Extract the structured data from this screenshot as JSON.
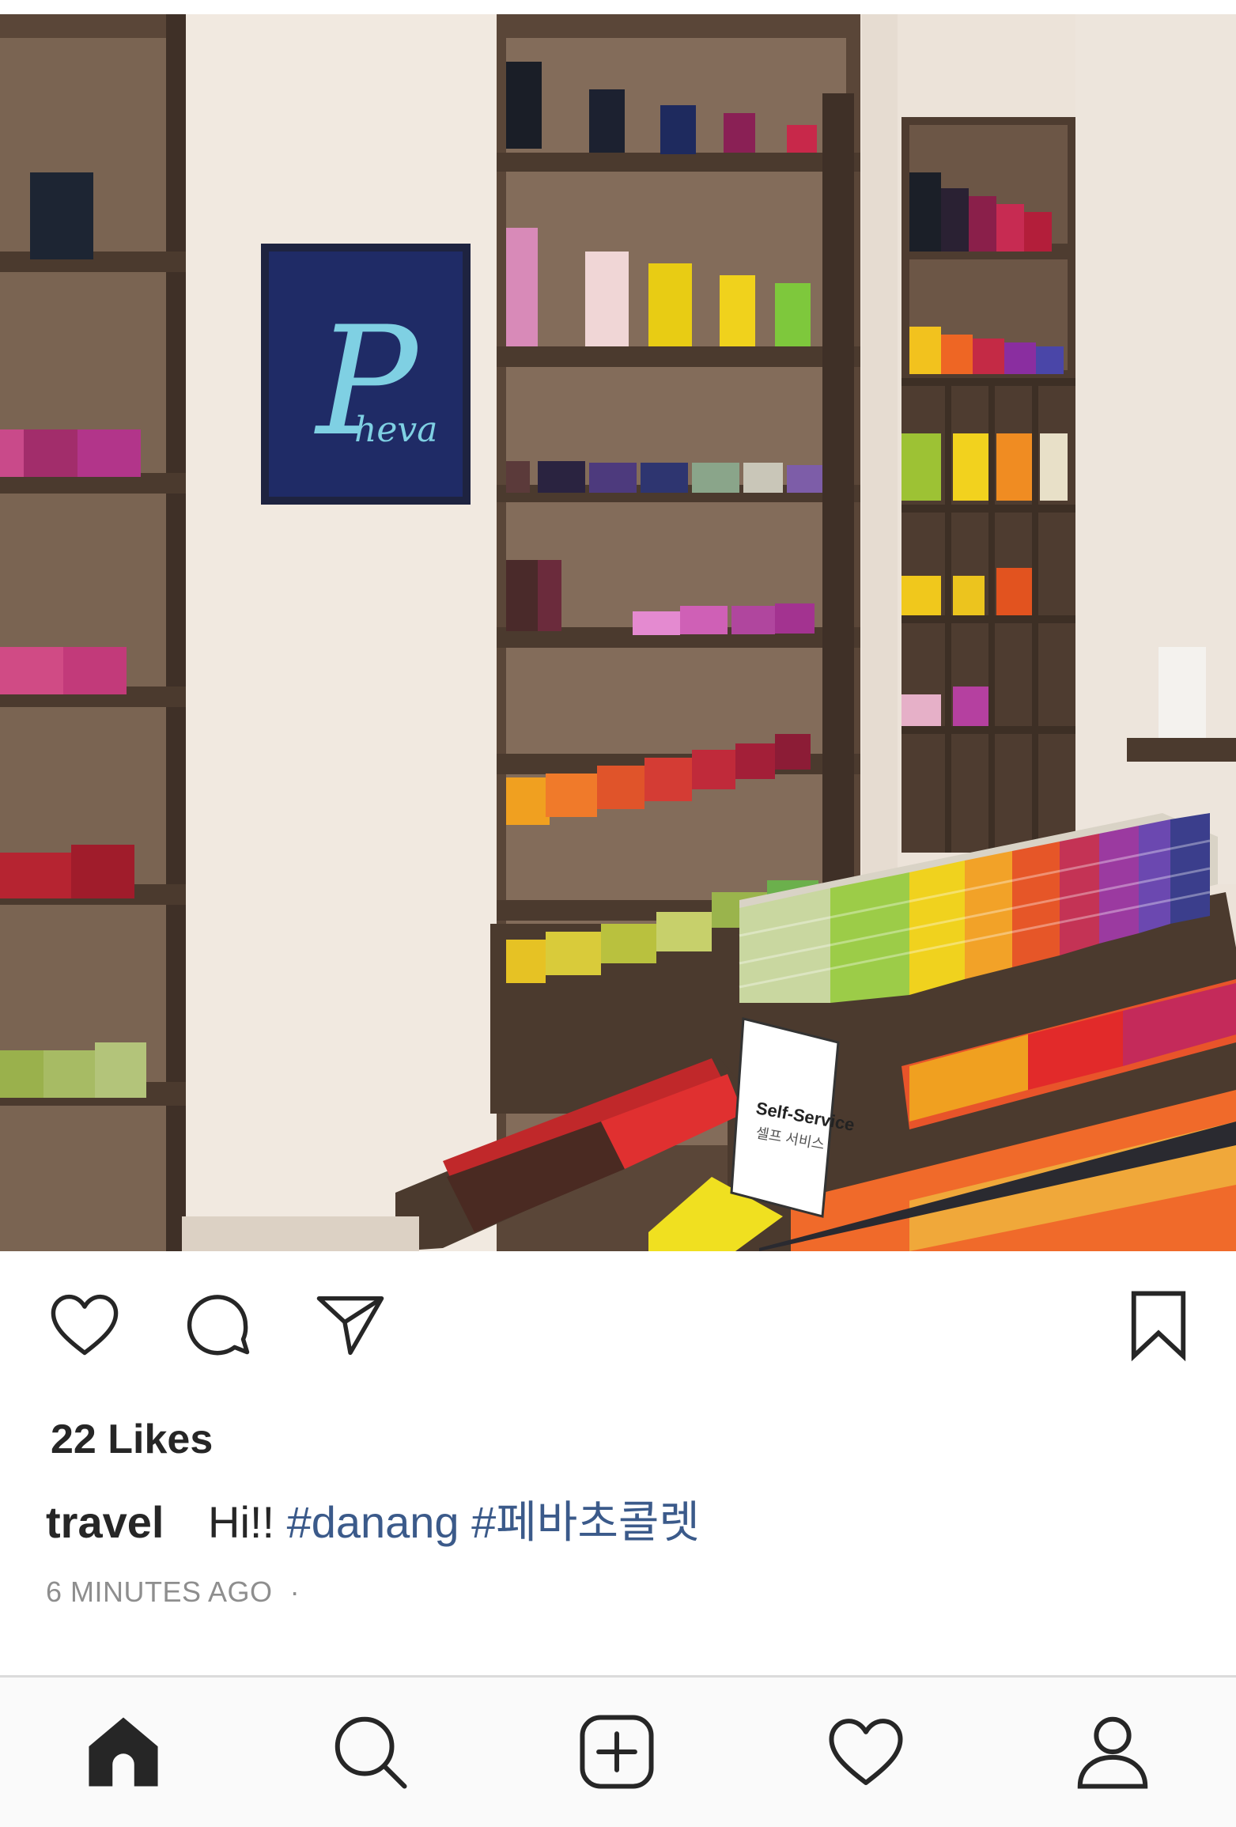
{
  "post": {
    "image_alt": "Chocolate shop interior with colorful boxes on wooden shelves",
    "screen_logo_text": "heva",
    "screen_logo_initial": "P",
    "sign_title": "Self-Service",
    "sign_subtitle": "셀프 서비스"
  },
  "actions": {
    "like_icon": "heart-outline-icon",
    "comment_icon": "comment-bubble-icon",
    "share_icon": "paper-plane-icon",
    "save_icon": "bookmark-icon"
  },
  "likes_text": "22 Likes",
  "caption": {
    "username": "travel",
    "message": "Hi!!",
    "hashtags": [
      "#danang",
      "#페바초콜렛"
    ]
  },
  "timestamp": "6 MINUTES AGO",
  "timestamp_separator": "·",
  "nav": {
    "home_icon": "home-icon",
    "search_icon": "search-icon",
    "add_icon": "add-post-icon",
    "activity_icon": "heart-icon",
    "profile_icon": "profile-icon"
  }
}
